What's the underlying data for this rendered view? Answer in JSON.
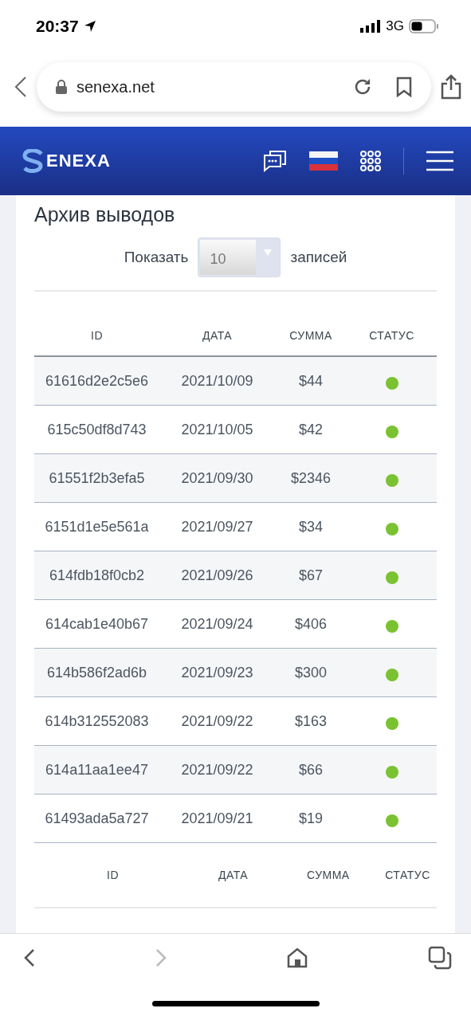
{
  "status_bar": {
    "time": "20:37",
    "network": "3G"
  },
  "browser": {
    "url": "senexa.net"
  },
  "site_header": {
    "logo_text": "ENEXA"
  },
  "archive": {
    "title": "Архив выводов",
    "show_label": "Показать",
    "page_size": "10",
    "entries_label": "записей",
    "columns": [
      "ID",
      "ДАТА",
      "СУММА",
      "СТАТУС"
    ],
    "rows": [
      {
        "id": "61616d2e2c5e6",
        "date": "2021/10/09",
        "amount": "$44",
        "color": "#7ac231"
      },
      {
        "id": "615c50df8d743",
        "date": "2021/10/05",
        "amount": "$42",
        "color": "#7ac231"
      },
      {
        "id": "61551f2b3efa5",
        "date": "2021/09/30",
        "amount": "$2346",
        "color": "#7ac231"
      },
      {
        "id": "6151d1e5e561a",
        "date": "2021/09/27",
        "amount": "$34",
        "color": "#7ac231"
      },
      {
        "id": "614fdb18f0cb2",
        "date": "2021/09/26",
        "amount": "$67",
        "color": "#7ac231"
      },
      {
        "id": "614cab1e40b67",
        "date": "2021/09/24",
        "amount": "$406",
        "color": "#7ac231"
      },
      {
        "id": "614b586f2ad6b",
        "date": "2021/09/23",
        "amount": "$300",
        "color": "#7ac231"
      },
      {
        "id": "614b312552083",
        "date": "2021/09/22",
        "amount": "$163",
        "color": "#7ac231"
      },
      {
        "id": "614a11aa1ee47",
        "date": "2021/09/22",
        "amount": "$66",
        "color": "#7ac231"
      },
      {
        "id": "61493ada5a727",
        "date": "2021/09/21",
        "amount": "$19",
        "color": "#7ac231"
      }
    ],
    "footer_columns": [
      "ID",
      "ДАТА",
      "СУММА",
      "СТАТУС"
    ]
  }
}
